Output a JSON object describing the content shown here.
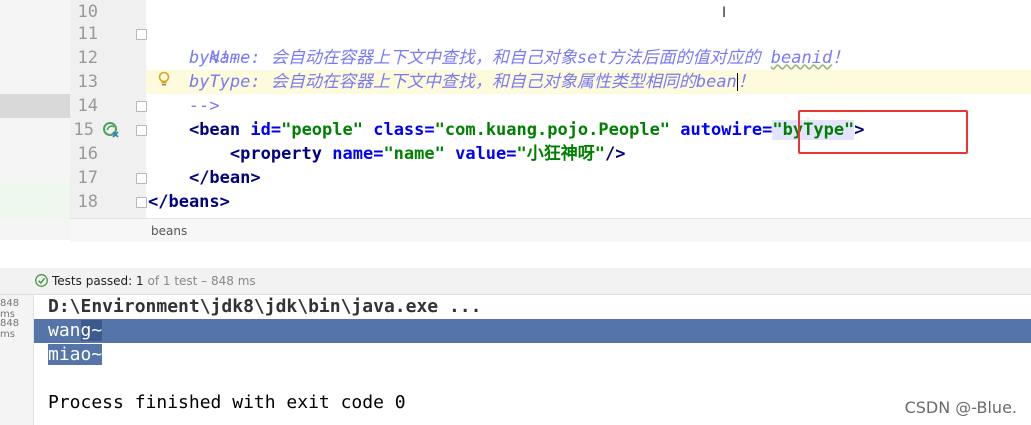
{
  "editor": {
    "line_numbers": [
      "10",
      "11",
      "12",
      "13",
      "14",
      "15",
      "16",
      "17",
      "18"
    ],
    "comment_open": "<!--",
    "byname_label": "byName:",
    "byname_text": " 会自动在容器上下文中查找，和自己对象set方法后面的值对应的 ",
    "byname_word": "beanid",
    "byname_end": "！",
    "bytype_label": "byType:",
    "bytype_text": " 会自动在容器上下文中查找，和自己对象属性类型相同的bean",
    "bytype_end": "！",
    "comment_close": "-->",
    "bean_open": "<bean ",
    "id_attr": "id=",
    "id_val": "\"people\"",
    "class_attr": " class=",
    "class_val": "\"com.kuang.pojo.People\"",
    "autowire_attr": " autowire=",
    "autowire_val": "\"byType\"",
    "bean_open_end": ">",
    "property_open": "<property ",
    "name_attr": "name=",
    "name_val": "\"name\"",
    "value_attr": " value=",
    "value_val": "\"小狂神呀\"",
    "property_end": "/>",
    "bean_close": "</bean>",
    "beans_close": "</beans>",
    "breadcrumb": "beans"
  },
  "tests": {
    "status_label": "Tests passed:",
    "status_count": " 1",
    "status_detail": " of 1 test – 848 ms"
  },
  "console": {
    "timings": [
      "848 ms",
      "848 ms"
    ],
    "command": "D:\\Environment\\jdk8\\jdk\\bin\\java.exe ...",
    "line1_a": "wan",
    "line1_b": "g~",
    "line2": "miao~",
    "finish": "Process finished with exit code 0"
  },
  "watermark": "CSDN @-Blue.",
  "colors": {
    "comment": "#7a7af5",
    "tag": "#000080",
    "attr": "#0000ff",
    "string": "#008000",
    "selection": "#5574a8",
    "highlight_box": "#ee3333"
  }
}
